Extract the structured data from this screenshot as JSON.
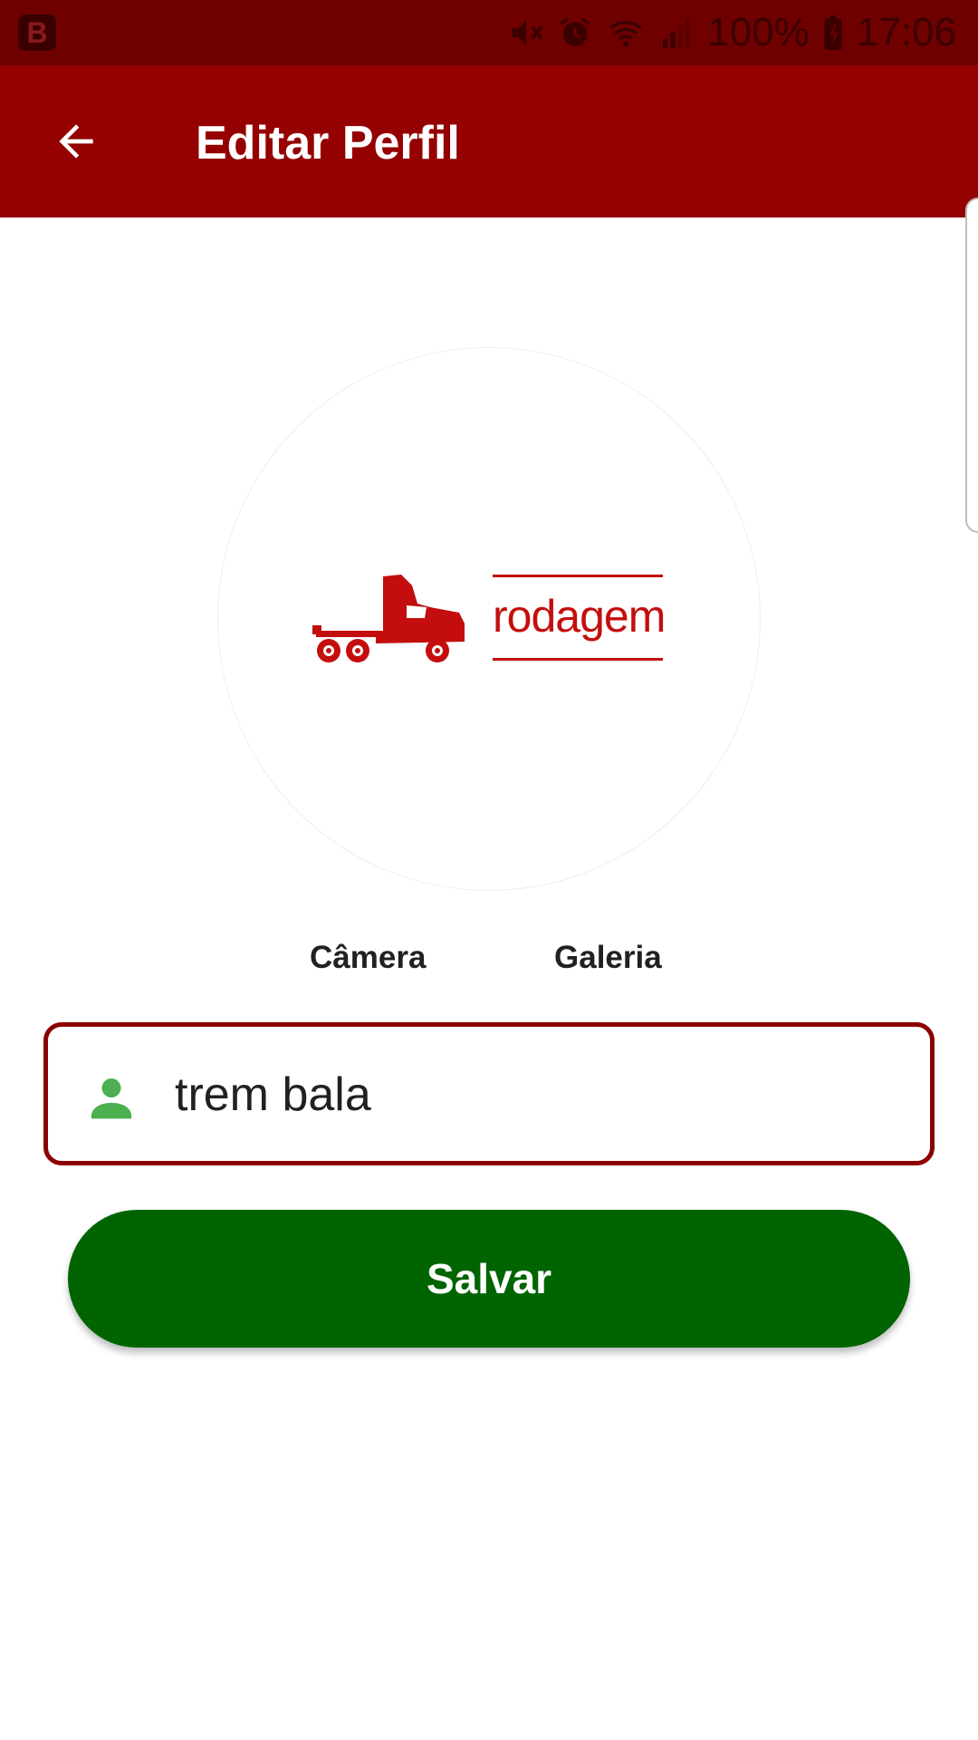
{
  "status_bar": {
    "app_badge": "B",
    "icons": [
      "mute-icon",
      "alarm-icon",
      "wifi-icon",
      "signal-icon",
      "battery-charging-icon"
    ],
    "battery": "100%",
    "time": "17:06"
  },
  "app_bar": {
    "title": "Editar Perfil",
    "back_icon": "arrow-left-icon",
    "color": "#950000"
  },
  "profile": {
    "logo_text": "rodagem",
    "logo_color": "#c40e0e"
  },
  "photo_options": {
    "camera": "Câmera",
    "gallery": "Galeria"
  },
  "name_field": {
    "icon": "person-icon",
    "value": "trem bala",
    "border_color": "#8b0000",
    "icon_color": "#4caf50"
  },
  "save_button": {
    "label": "Salvar",
    "color": "#006400"
  }
}
